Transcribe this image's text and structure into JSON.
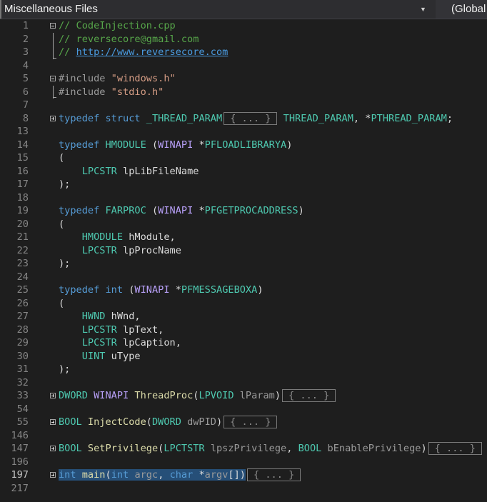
{
  "topbar": {
    "project": "Miscellaneous Files",
    "scope": "(Global Scope)",
    "dropdown_icon": "triangle-down-icon"
  },
  "colors": {
    "background": "#1e1e1e",
    "comment": "#57a64a",
    "keyword": "#569cd6",
    "type": "#4ec9b0",
    "string": "#d69d85",
    "function": "#dcdcaa",
    "macro": "#b8a0f8",
    "parameter": "#9a9a9a",
    "selection": "#264f78"
  },
  "current_line": "197",
  "lines": [
    {
      "n": "1",
      "fold": "minus",
      "tokens": [
        [
          "c",
          "// CodeInjection.cpp"
        ]
      ]
    },
    {
      "n": "2",
      "guide": "mid",
      "tokens": [
        [
          "c",
          "// reversecore@gmail.com"
        ]
      ]
    },
    {
      "n": "3",
      "guide": "end",
      "tokens": [
        [
          "c",
          "// "
        ],
        [
          "u",
          "http://www.reversecore.com"
        ]
      ]
    },
    {
      "n": "4",
      "tokens": []
    },
    {
      "n": "5",
      "fold": "minus",
      "tokens": [
        [
          "pp",
          "#include "
        ],
        [
          "s",
          "\"windows.h\""
        ]
      ]
    },
    {
      "n": "6",
      "guide": "end",
      "tokens": [
        [
          "pp",
          "#include "
        ],
        [
          "s",
          "\"stdio.h\""
        ]
      ]
    },
    {
      "n": "7",
      "tokens": []
    },
    {
      "n": "8",
      "fold": "plus",
      "tokens": [
        [
          "k",
          "typedef "
        ],
        [
          "k",
          "struct "
        ],
        [
          "t",
          "_THREAD_PARAM"
        ],
        [
          "box",
          "{ ... }"
        ],
        [
          "n",
          " "
        ],
        [
          "t",
          "THREAD_PARAM"
        ],
        [
          "n",
          ", *"
        ],
        [
          "t",
          "PTHREAD_PARAM"
        ],
        [
          "n",
          ";"
        ]
      ]
    },
    {
      "n": "13",
      "tokens": []
    },
    {
      "n": "14",
      "tokens": [
        [
          "k",
          "typedef "
        ],
        [
          "t",
          "HMODULE "
        ],
        [
          "n",
          "("
        ],
        [
          "m",
          "WINAPI"
        ],
        [
          "n",
          " *"
        ],
        [
          "t",
          "PFLOADLIBRARYA"
        ],
        [
          "n",
          ")"
        ]
      ]
    },
    {
      "n": "15",
      "tokens": [
        [
          "n",
          "("
        ]
      ]
    },
    {
      "n": "16",
      "tokens": [
        [
          "n",
          "    "
        ],
        [
          "t",
          "LPCSTR "
        ],
        [
          "n",
          "lpLibFileName"
        ]
      ]
    },
    {
      "n": "17",
      "tokens": [
        [
          "n",
          ");"
        ]
      ]
    },
    {
      "n": "18",
      "tokens": []
    },
    {
      "n": "19",
      "tokens": [
        [
          "k",
          "typedef "
        ],
        [
          "t",
          "FARPROC "
        ],
        [
          "n",
          "("
        ],
        [
          "m",
          "WINAPI"
        ],
        [
          "n",
          " *"
        ],
        [
          "t",
          "PFGETPROCADDRESS"
        ],
        [
          "n",
          ")"
        ]
      ]
    },
    {
      "n": "20",
      "tokens": [
        [
          "n",
          "("
        ]
      ]
    },
    {
      "n": "21",
      "tokens": [
        [
          "n",
          "    "
        ],
        [
          "t",
          "HMODULE "
        ],
        [
          "n",
          "hModule,"
        ]
      ]
    },
    {
      "n": "22",
      "tokens": [
        [
          "n",
          "    "
        ],
        [
          "t",
          "LPCSTR "
        ],
        [
          "n",
          "lpProcName"
        ]
      ]
    },
    {
      "n": "23",
      "tokens": [
        [
          "n",
          ");"
        ]
      ]
    },
    {
      "n": "24",
      "tokens": []
    },
    {
      "n": "25",
      "tokens": [
        [
          "k",
          "typedef "
        ],
        [
          "k",
          "int "
        ],
        [
          "n",
          "("
        ],
        [
          "m",
          "WINAPI"
        ],
        [
          "n",
          " *"
        ],
        [
          "t",
          "PFMESSAGEBOXA"
        ],
        [
          "n",
          ")"
        ]
      ]
    },
    {
      "n": "26",
      "tokens": [
        [
          "n",
          "("
        ]
      ]
    },
    {
      "n": "27",
      "tokens": [
        [
          "n",
          "    "
        ],
        [
          "t",
          "HWND "
        ],
        [
          "n",
          "hWnd,"
        ]
      ]
    },
    {
      "n": "28",
      "tokens": [
        [
          "n",
          "    "
        ],
        [
          "t",
          "LPCSTR "
        ],
        [
          "n",
          "lpText,"
        ]
      ]
    },
    {
      "n": "29",
      "tokens": [
        [
          "n",
          "    "
        ],
        [
          "t",
          "LPCSTR "
        ],
        [
          "n",
          "lpCaption,"
        ]
      ]
    },
    {
      "n": "30",
      "tokens": [
        [
          "n",
          "    "
        ],
        [
          "t",
          "UINT "
        ],
        [
          "n",
          "uType"
        ]
      ]
    },
    {
      "n": "31",
      "tokens": [
        [
          "n",
          ");"
        ]
      ]
    },
    {
      "n": "32",
      "tokens": []
    },
    {
      "n": "33",
      "fold": "plus",
      "tokens": [
        [
          "t",
          "DWORD "
        ],
        [
          "m",
          "WINAPI "
        ],
        [
          "f",
          "ThreadProc"
        ],
        [
          "n",
          "("
        ],
        [
          "t",
          "LPVOID "
        ],
        [
          "p",
          "lParam"
        ],
        [
          "n",
          ")"
        ],
        [
          "box",
          "{ ... }"
        ]
      ]
    },
    {
      "n": "54",
      "tokens": []
    },
    {
      "n": "55",
      "fold": "plus",
      "tokens": [
        [
          "t",
          "BOOL "
        ],
        [
          "f",
          "InjectCode"
        ],
        [
          "n",
          "("
        ],
        [
          "t",
          "DWORD "
        ],
        [
          "p",
          "dwPID"
        ],
        [
          "n",
          ")"
        ],
        [
          "box",
          "{ ... }"
        ]
      ]
    },
    {
      "n": "146",
      "tokens": []
    },
    {
      "n": "147",
      "fold": "plus",
      "tokens": [
        [
          "t",
          "BOOL "
        ],
        [
          "f",
          "SetPrivilege"
        ],
        [
          "n",
          "("
        ],
        [
          "t",
          "LPCTSTR "
        ],
        [
          "p",
          "lpszPrivilege"
        ],
        [
          "n",
          ", "
        ],
        [
          "t",
          "BOOL "
        ],
        [
          "p",
          "bEnablePrivilege"
        ],
        [
          "n",
          ")"
        ],
        [
          "box",
          "{ ... }"
        ]
      ]
    },
    {
      "n": "196",
      "tokens": []
    },
    {
      "n": "197",
      "fold": "plus",
      "selected": true,
      "tokens": [
        [
          "k",
          "int "
        ],
        [
          "f",
          "main"
        ],
        [
          "n",
          "("
        ],
        [
          "k",
          "int "
        ],
        [
          "p",
          "argc"
        ],
        [
          "n",
          ", "
        ],
        [
          "k",
          "char "
        ],
        [
          "n",
          "*"
        ],
        [
          "p",
          "argv"
        ],
        [
          "n",
          "[])"
        ],
        [
          "box",
          "{ ... }"
        ]
      ]
    },
    {
      "n": "217",
      "tokens": []
    }
  ]
}
